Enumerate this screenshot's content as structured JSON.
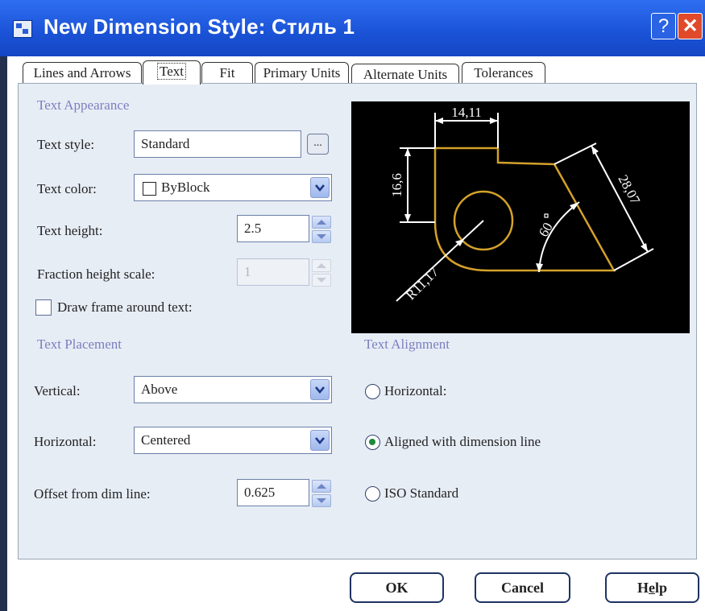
{
  "window": {
    "title": "New Dimension Style: Стиль 1",
    "help_glyph": "?",
    "close_glyph": "✕"
  },
  "tabs": [
    {
      "label": "Lines and Arrows",
      "active": false
    },
    {
      "label": "Text",
      "active": true
    },
    {
      "label": "Fit",
      "active": false
    },
    {
      "label": "Primary Units",
      "active": false
    },
    {
      "label": "Alternate Units",
      "active": false
    },
    {
      "label": "Tolerances",
      "active": false
    }
  ],
  "text_appearance": {
    "title": "Text Appearance",
    "text_style_label": "Text style:",
    "text_style_value": "Standard",
    "browse_label": "...",
    "text_color_label": "Text color:",
    "text_color_value": "ByBlock",
    "text_height_label": "Text height:",
    "text_height_value": "2.5",
    "fraction_label": "Fraction height scale:",
    "fraction_value": "1",
    "frame_label": "Draw frame around text:",
    "frame_checked": false
  },
  "text_placement": {
    "title": "Text Placement",
    "vertical_label": "Vertical:",
    "vertical_value": "Above",
    "horizontal_label": "Horizontal:",
    "horizontal_value": "Centered",
    "offset_label": "Offset from dim line:",
    "offset_value": "0.625"
  },
  "text_alignment": {
    "title": "Text Alignment",
    "options": [
      {
        "label": "Horizontal:",
        "checked": false
      },
      {
        "label": "Aligned with dimension line",
        "checked": true
      },
      {
        "label": "ISO Standard",
        "checked": false
      }
    ]
  },
  "preview": {
    "dim_top": "14,11",
    "dim_left": "16,6",
    "dim_diag": "28,07",
    "dim_angle": "60",
    "dim_radius": "R11,17",
    "colors": {
      "background": "#000000",
      "outline": "#d4a12a",
      "dimension": "#ffffff"
    }
  },
  "buttons": {
    "ok": "OK",
    "cancel": "Cancel",
    "help": "Help"
  },
  "colors": {
    "titlebar": "#1a52d6",
    "panel": "#e7edf5",
    "group_title": "#7b7fbf",
    "close": "#e04a2a",
    "radio_dot": "#1f8a3c"
  }
}
